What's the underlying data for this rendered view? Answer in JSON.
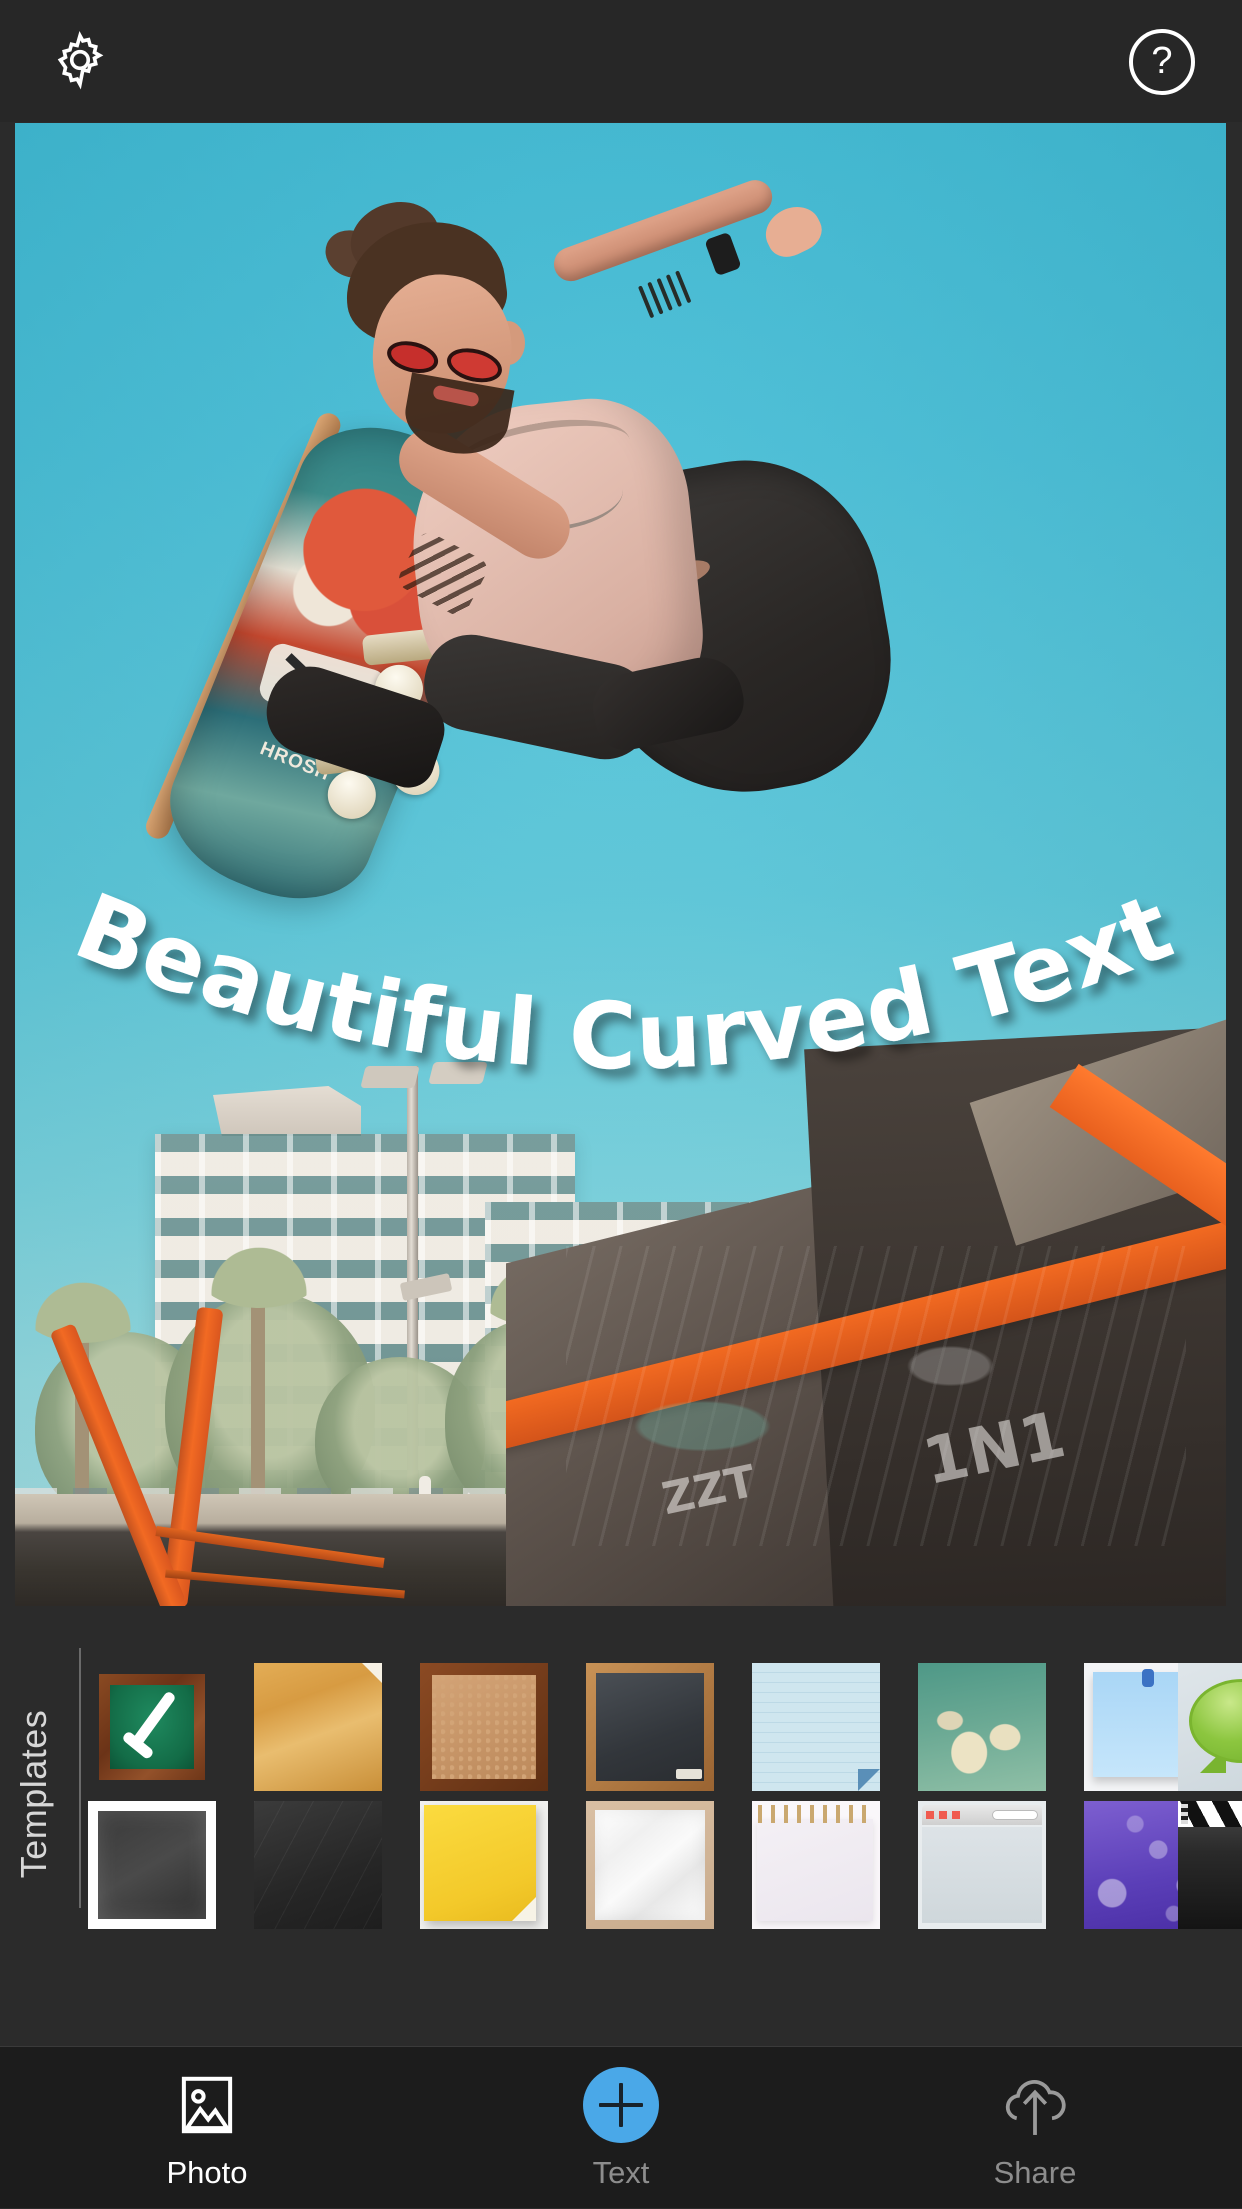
{
  "topbar": {
    "settings_icon": "gear-icon",
    "help_icon": "help-circle-icon",
    "help_glyph": "?"
  },
  "canvas": {
    "overlay_text": "Beautiful Curved Text",
    "text_color": "#ffffff",
    "photo_description": "skateboarder-midair-over-skatepark",
    "board_label": "HROSH"
  },
  "templates_panel": {
    "label": "Templates",
    "selected_index": 0,
    "rows": [
      [
        {
          "name": "green-chalkboard-wood-frame",
          "selected": true
        },
        {
          "name": "old-gold-parchment",
          "selected": false
        },
        {
          "name": "cork-board-wood-frame",
          "selected": false
        },
        {
          "name": "black-chalkboard-wood-frame",
          "selected": false
        },
        {
          "name": "blue-lined-notebook-paper",
          "selected": false
        },
        {
          "name": "vintage-green-sky-clouds",
          "selected": false
        },
        {
          "name": "blue-pinned-sticky-note",
          "selected": false
        },
        {
          "name": "green-speech-bubble",
          "selected": false
        }
      ],
      [
        {
          "name": "grunge-black-border",
          "selected": false
        },
        {
          "name": "dark-slate-chalkboard",
          "selected": false
        },
        {
          "name": "yellow-sticky-note",
          "selected": false
        },
        {
          "name": "crumpled-white-paper",
          "selected": false
        },
        {
          "name": "spiral-notepad",
          "selected": false
        },
        {
          "name": "mac-window-frame",
          "selected": false
        },
        {
          "name": "purple-bokeh",
          "selected": false
        },
        {
          "name": "film-clapperboard",
          "selected": false
        }
      ]
    ]
  },
  "bottom_nav": {
    "items": [
      {
        "label": "Photo",
        "icon": "photo-image-icon",
        "active": true
      },
      {
        "label": "Text",
        "icon": "plus-circle-icon",
        "active": false
      },
      {
        "label": "Share",
        "icon": "cloud-upload-icon",
        "active": false
      }
    ],
    "accent_color": "#4aa8e8"
  }
}
